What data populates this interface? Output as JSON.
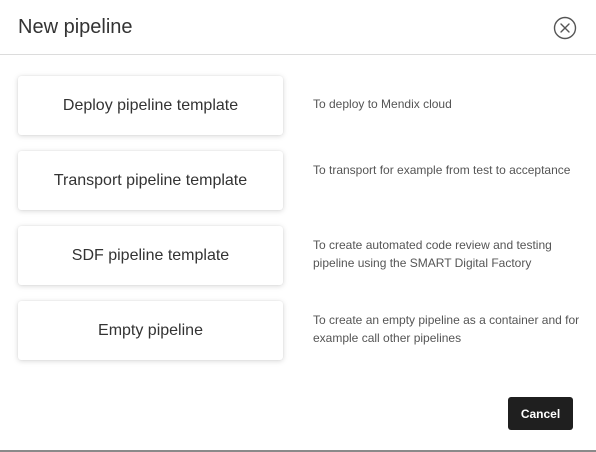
{
  "dialog": {
    "title": "New pipeline",
    "close_icon": "close-circle-icon"
  },
  "options": [
    {
      "label": "Deploy pipeline template",
      "description": "To deploy to Mendix cloud"
    },
    {
      "label": "Transport pipeline template",
      "description": "To transport for example from test to acceptance"
    },
    {
      "label": "SDF pipeline template",
      "description": "To create automated code review and testing pipeline using the SMART Digital Factory"
    },
    {
      "label": "Empty pipeline",
      "description": "To create an empty pipeline as a container and for example call other pipelines"
    }
  ],
  "footer": {
    "cancel_label": "Cancel"
  },
  "colors": {
    "cancel_background": "#1f1f1f",
    "text": "#333333",
    "description_text": "#555555"
  }
}
